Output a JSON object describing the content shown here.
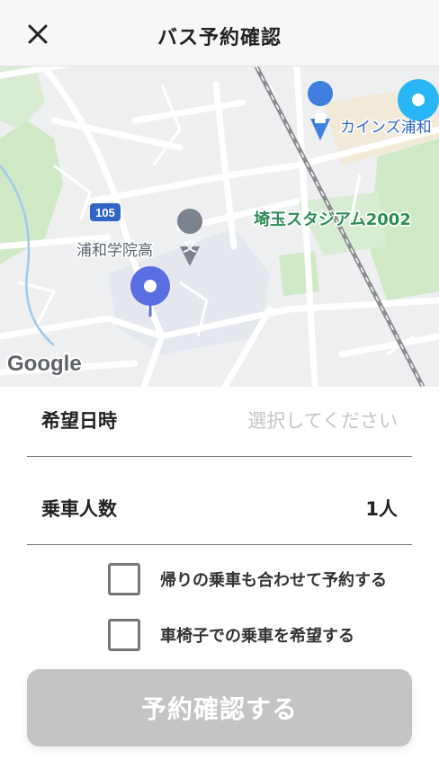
{
  "header": {
    "title": "バス予約確認",
    "close_icon": "close-icon"
  },
  "map": {
    "road_badge": "105",
    "school_label": "浦和学院高",
    "school_icon_char": "文",
    "stadium_label": "埼玉スタジアム2002",
    "store_label": "カインズ浦和",
    "google_logo": "Google",
    "pin_color": "#5b6ee1",
    "stop_color": "#29b6f6",
    "park_color": "#cfe8c6"
  },
  "form": {
    "datetime_label": "希望日時",
    "datetime_placeholder": "選択してください",
    "passengers_label": "乗車人数",
    "passengers_value": "1人",
    "return_checkbox_label": "帰りの乗車も合わせて予約する",
    "wheelchair_checkbox_label": "車椅子での乗車を希望する"
  },
  "submit": {
    "label": "予約確認する",
    "color": "#c4c4c4"
  }
}
